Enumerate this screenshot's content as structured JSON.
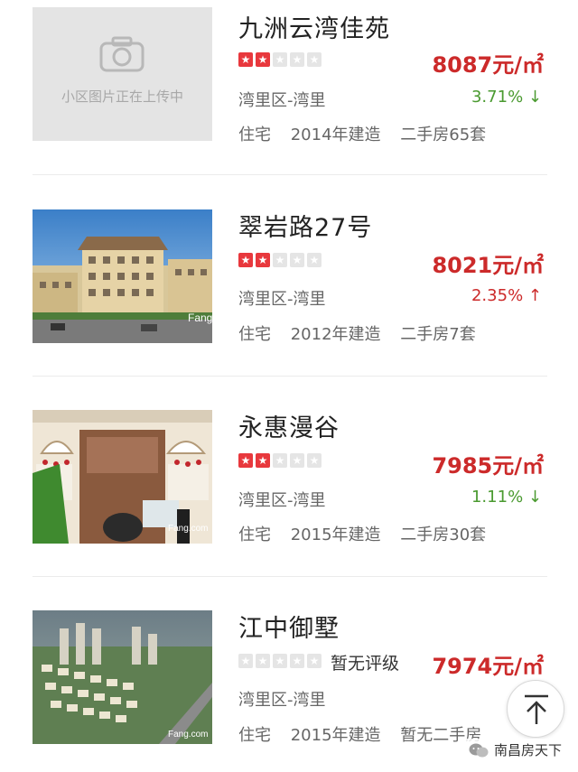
{
  "listings": [
    {
      "name": "九洲云湾佳苑",
      "image_placeholder_text": "小区图片正在上传中",
      "rating_stars": 2,
      "rating_text": "",
      "price": "8087元/㎡",
      "district": "湾里区-湾里",
      "change": "3.71%",
      "change_arrow": "↓",
      "change_direction": "down",
      "info": {
        "type": "住宅",
        "built": "2014年建造",
        "secondhand": "二手房65套"
      }
    },
    {
      "name": "翠岩路27号",
      "image_watermark": "Fang",
      "rating_stars": 2,
      "rating_text": "",
      "price": "8021元/㎡",
      "district": "湾里区-湾里",
      "change": "2.35%",
      "change_arrow": "↑",
      "change_direction": "up",
      "info": {
        "type": "住宅",
        "built": "2012年建造",
        "secondhand": "二手房7套"
      }
    },
    {
      "name": "永惠漫谷",
      "image_watermark": "Fang.com",
      "rating_stars": 2,
      "rating_text": "",
      "price": "7985元/㎡",
      "district": "湾里区-湾里",
      "change": "1.11%",
      "change_arrow": "↓",
      "change_direction": "down",
      "info": {
        "type": "住宅",
        "built": "2015年建造",
        "secondhand": "二手房30套"
      }
    },
    {
      "name": "江中御墅",
      "image_watermark": "Fang.com",
      "rating_stars": 0,
      "rating_text": "暂无评级",
      "price": "7974元/㎡",
      "district": "湾里区-湾里",
      "change": "",
      "change_arrow": "",
      "change_direction": "",
      "info": {
        "type": "住宅",
        "built": "2015年建造",
        "secondhand": "暂无二手房"
      }
    }
  ],
  "watermark": {
    "text": "南昌房天下"
  },
  "icons": {
    "back_to_top": "arrow-up-icon",
    "placeholder": "camera-icon",
    "star": "star-icon"
  },
  "colors": {
    "price": "#cc2a2a",
    "rating_on": "#e8383d",
    "change_down": "#4a9a30",
    "change_up": "#cc2a2a"
  }
}
